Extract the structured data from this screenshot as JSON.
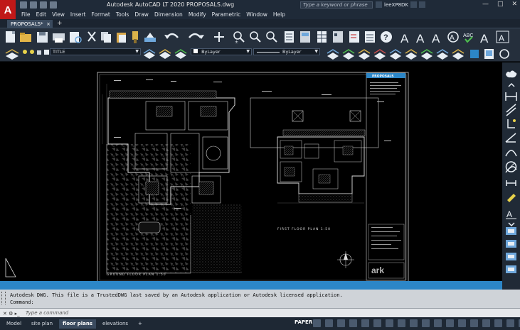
{
  "app": {
    "logo_letter": "A",
    "title": "Autodesk AutoCAD LT 2020   PROPOSALS.dwg",
    "search_placeholder": "Type a keyword or phrase",
    "user": "leeXP8DK"
  },
  "window_controls": {
    "minimize": "—",
    "maximize": "□",
    "close": "✕"
  },
  "menu": [
    "File",
    "Edit",
    "View",
    "Insert",
    "Format",
    "Tools",
    "Draw",
    "Dimension",
    "Modify",
    "Parametric",
    "Window",
    "Help"
  ],
  "tabs": {
    "active": "PROPOSALS*",
    "close": "×",
    "add": "+"
  },
  "layer_panel": {
    "current_layer": "TITLE",
    "color": "ByLayer",
    "linetype": "ByLayer"
  },
  "drawing": {
    "title_block_heading": "PROPOSALS",
    "ground_label": "GROUND FLOOR PLAN 1:50",
    "first_label": "FIRST FLOOR PLAN 1:50",
    "watermark": "ark"
  },
  "command": {
    "history_line1": "Autodesk DWG.  This file is a TrustedDWG last saved by an Autodesk application or Autodesk licensed application.",
    "history_line2": "Command:",
    "prompt_placeholder": "Type a command"
  },
  "layouts": [
    {
      "label": "Model",
      "active": false
    },
    {
      "label": "site plan",
      "active": false
    },
    {
      "label": "floor plans",
      "active": true
    },
    {
      "label": "elevations",
      "active": false
    }
  ],
  "status": {
    "space": "PAPER"
  },
  "colors": {
    "accent_blue": "#2c86c7",
    "toolbar_bg": "#252f3c",
    "logo_red": "#c01818"
  }
}
